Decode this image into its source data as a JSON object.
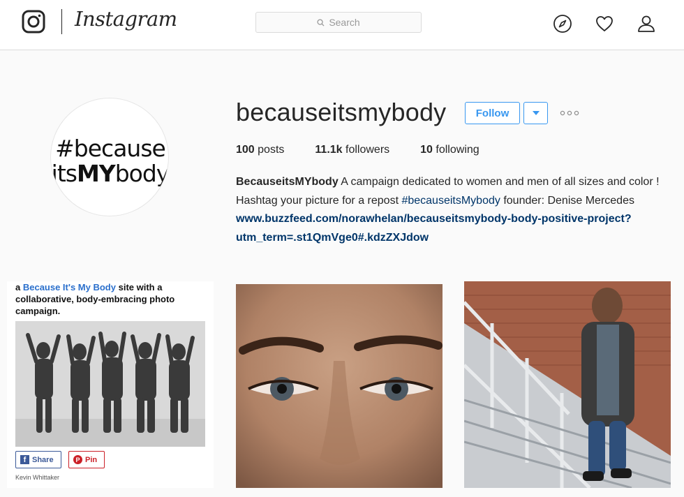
{
  "header": {
    "logo_text": "Instagram",
    "search_placeholder": "Search",
    "nav_icons": [
      "compass-icon",
      "heart-icon",
      "user-icon"
    ]
  },
  "profile": {
    "avatar_line1": "#because",
    "avatar_line2_pre": "its",
    "avatar_line2_bold": "MY",
    "avatar_line2_post": "body",
    "username": "becauseitsmybody",
    "follow_label": "Follow",
    "stats": {
      "posts_count": "100",
      "posts_label": "posts",
      "followers_count": "11.1k",
      "followers_label": "followers",
      "following_count": "10",
      "following_label": "following"
    },
    "bio": {
      "name": "BecauseitsMYbody",
      "text1": " A campaign dedicated to women and men of all sizes and color ! Hashtag your picture for a repost ",
      "hashtag": "#becauseitsMybody",
      "text2": " founder: Denise Mercedes ",
      "link": "www.buzzfeed.com/norawhelan/becauseitsmybody-body-positive-project?utm_term=.st1QmVge0#.kdzZXJdow"
    }
  },
  "posts": {
    "post1": {
      "text_pre": "a ",
      "text_link": "Because It's My Body",
      "text_post": " site with a collaborative, body-embracing photo campaign.",
      "share_label": "Share",
      "pin_label": "Pin",
      "credit": "Kevin Whittaker"
    }
  },
  "colors": {
    "accent": "#3897f0",
    "link": "#003569",
    "border": "#dbdbdb",
    "background": "#fafafa"
  }
}
